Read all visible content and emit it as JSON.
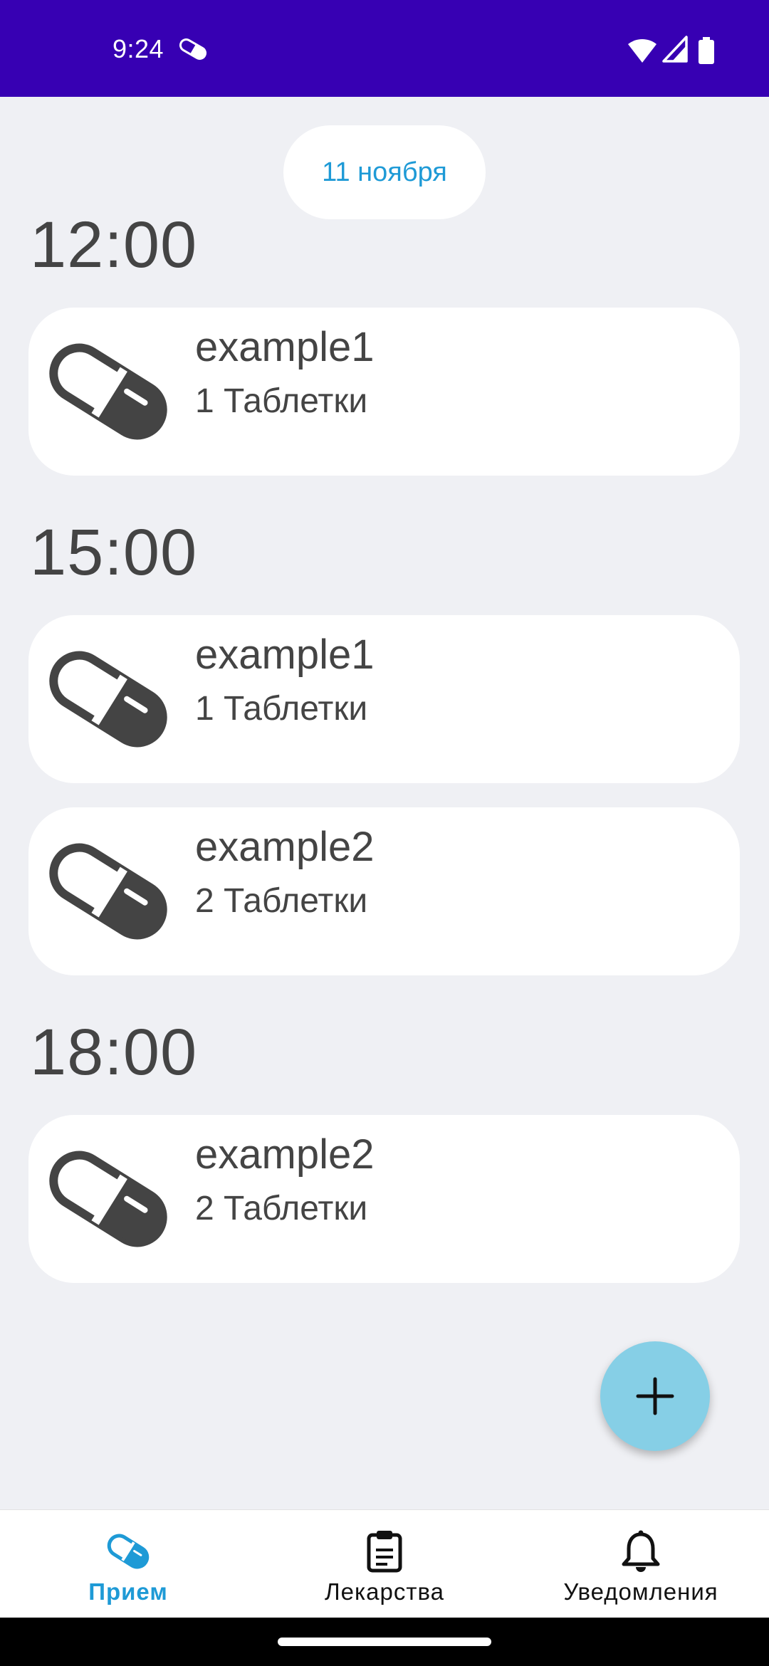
{
  "status_bar": {
    "time": "9:24"
  },
  "date_chip": {
    "label": "11 ноября"
  },
  "schedule": [
    {
      "time": "12:00",
      "items": [
        {
          "name": "example1",
          "dose": "1 Таблетки"
        }
      ]
    },
    {
      "time": "15:00",
      "items": [
        {
          "name": "example1",
          "dose": "1 Таблетки"
        },
        {
          "name": "example2",
          "dose": "2 Таблетки"
        }
      ]
    },
    {
      "time": "18:00",
      "items": [
        {
          "name": "example2",
          "dose": "2 Таблетки"
        }
      ]
    }
  ],
  "fab": {
    "icon": "plus-icon"
  },
  "bottom_nav": {
    "items": [
      {
        "label": "Прием",
        "icon": "pill-icon",
        "active": true
      },
      {
        "label": "Лекарства",
        "icon": "clipboard-icon",
        "active": false
      },
      {
        "label": "Уведомления",
        "icon": "bell-icon",
        "active": false
      }
    ]
  },
  "colors": {
    "status_bar": "#3700b3",
    "accent": "#1e9ad6",
    "fab": "#86cfe6",
    "background": "#eff0f4",
    "icon": "#444444"
  }
}
